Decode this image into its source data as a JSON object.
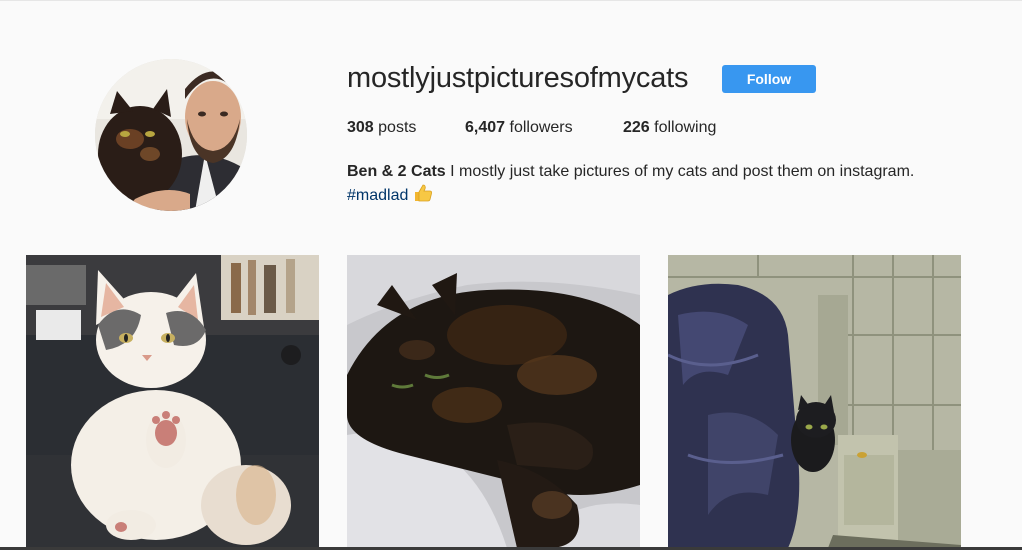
{
  "profile": {
    "username": "mostlyjustpicturesofmycats",
    "follow_label": "Follow",
    "avatar_icon": "profile-photo-man-with-cat",
    "stats": {
      "posts_count": "308",
      "posts_label": " posts",
      "followers_count": "6,407",
      "followers_label": " followers",
      "following_count": "226",
      "following_label": " following"
    },
    "bio": {
      "name": "Ben & 2 Cats",
      "text": " I mostly just take pictures of my cats and post them on instagram.",
      "hashtag": "#madlad",
      "emoji_icon": "thumbs-up-icon"
    }
  },
  "posts": [
    {
      "icon": "white-cat-photo"
    },
    {
      "icon": "tortoiseshell-cat-sleeping-photo"
    },
    {
      "icon": "black-cat-on-tiles-photo"
    }
  ],
  "colors": {
    "follow_button": "#3897f0",
    "hashtag": "#003569",
    "background": "#fafafa",
    "text": "#262626"
  }
}
